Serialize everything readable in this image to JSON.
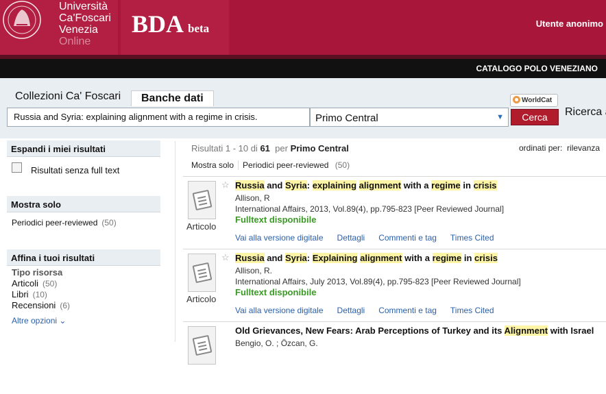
{
  "header": {
    "university_line1": "Università",
    "university_line2": "Ca'Foscari",
    "university_line3": "Venezia",
    "university_line4": "Online",
    "app_name": "BDA",
    "app_suffix": "beta",
    "user": "Utente anonimo",
    "catalog": "CATALOGO POLO VENEZIANO"
  },
  "tabs": [
    {
      "label": "Collezioni Ca' Foscari"
    },
    {
      "label": "Banche dati"
    }
  ],
  "search": {
    "value": "Russia and Syria: explaining alignment with a regime in crisis.",
    "scope": "Primo Central",
    "button": "Cerca",
    "worldcat": "WorldCat",
    "advanced": "Ricerca a"
  },
  "sidebar": {
    "expand_title": "Espandi i miei risultati",
    "expand_option": "Risultati senza full text",
    "show_title": "Mostra solo",
    "show_item": "Periodici peer-reviewed",
    "show_count": "(50)",
    "refine_title": "Affina i tuoi risultati",
    "resource_type": "Tipo risorsa",
    "types": [
      {
        "label": "Articoli",
        "count": "(50)"
      },
      {
        "label": "Libri",
        "count": "(10)"
      },
      {
        "label": "Recensioni",
        "count": "(6)"
      }
    ],
    "more": "Altre opzioni"
  },
  "results": {
    "summary_prefix": "Risultati 1 - 10 di",
    "total": "61",
    "per": "per",
    "scope": "Primo Central",
    "sort_label": "ordinati per:",
    "sort_value": "rilevanza",
    "filter_label": "Mostra solo",
    "filter_item": "Periodici peer-reviewed",
    "filter_count": "(50)"
  },
  "records": [
    {
      "type": "Articolo",
      "title_parts": [
        "Russia",
        " and ",
        "Syria",
        ": ",
        "explaining",
        " ",
        "alignment",
        " with a ",
        "regime",
        " in ",
        "crisis"
      ],
      "author": "Allison, R",
      "source": "International Affairs, 2013, Vol.89(4), pp.795-823 [Peer Reviewed Journal]",
      "availability": "Fulltext disponibile",
      "links": [
        "Vai alla versione digitale",
        "Dettagli",
        "Commenti e tag",
        "Times Cited"
      ]
    },
    {
      "type": "Articolo",
      "title_parts": [
        "Russia",
        " and ",
        "Syria",
        ": ",
        "Explaining",
        " ",
        "alignment",
        " with a ",
        "regime",
        " in ",
        "crisis"
      ],
      "author": "Allison, R.",
      "source": "International Affairs, July 2013, Vol.89(4), pp.795-823 [Peer Reviewed Journal]",
      "availability": "Fulltext disponibile",
      "links": [
        "Vai alla versione digitale",
        "Dettagli",
        "Commenti e tag",
        "Times Cited"
      ]
    },
    {
      "title_parts": [
        "Old Grievances, New Fears: Arab Perceptions of Turkey and its ",
        "Alignment",
        " with Israel"
      ],
      "author": "Bengio, O. ; Özcan, G."
    }
  ],
  "colors": {
    "header": "#a8173a",
    "button": "#b01c2c",
    "link": "#2a5fa8",
    "fulltext": "#3a9a25",
    "highlight": "#fdf4a5"
  }
}
